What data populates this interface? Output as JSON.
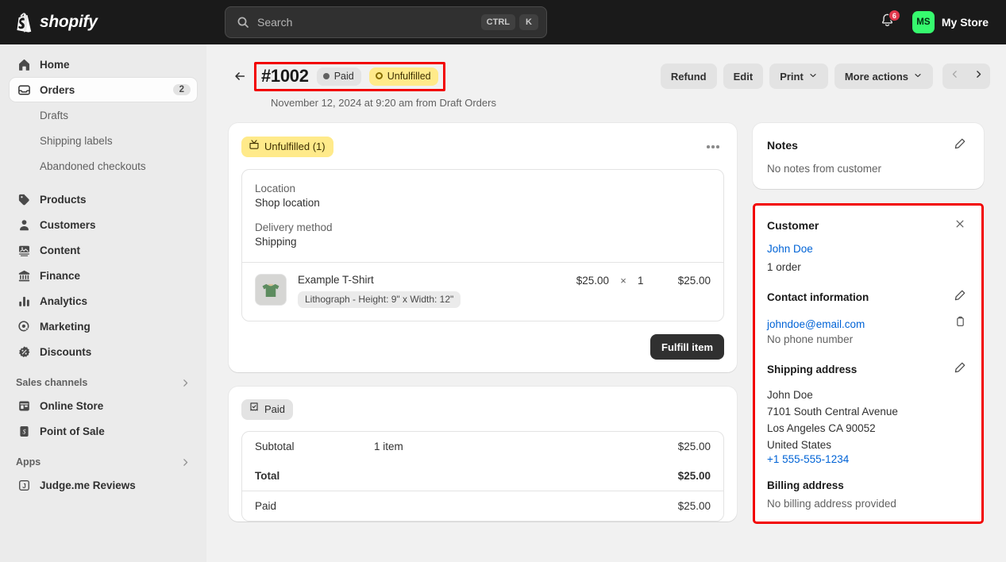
{
  "topbar": {
    "brand_name": "shopify",
    "brand_icon": "shopify-bag-icon",
    "search": {
      "placeholder": "Search",
      "icon": "search-icon",
      "kbd_ctrl": "CTRL",
      "kbd_k": "K"
    },
    "notifications": {
      "icon": "bell-icon",
      "count": "6"
    },
    "store": {
      "initials": "MS",
      "name": "My Store",
      "avatar_color": "#36fa6e"
    }
  },
  "sidebar": {
    "items": [
      {
        "label": "Home",
        "icon": "home-icon",
        "badge": "",
        "active": false
      },
      {
        "label": "Orders",
        "icon": "orders-inbox-icon",
        "badge": "2",
        "active": true
      }
    ],
    "sub_items": [
      {
        "label": "Drafts"
      },
      {
        "label": "Shipping labels"
      },
      {
        "label": "Abandoned checkouts"
      }
    ],
    "items2": [
      {
        "label": "Products",
        "icon": "tag-icon"
      },
      {
        "label": "Customers",
        "icon": "person-icon"
      },
      {
        "label": "Content",
        "icon": "content-image-icon"
      },
      {
        "label": "Finance",
        "icon": "bank-icon"
      },
      {
        "label": "Analytics",
        "icon": "bar-chart-icon"
      },
      {
        "label": "Marketing",
        "icon": "target-cursor-icon"
      },
      {
        "label": "Discounts",
        "icon": "discount-badge-icon"
      }
    ],
    "sales_channels": {
      "title": "Sales channels",
      "items": [
        {
          "label": "Online Store",
          "icon": "storefront-icon"
        },
        {
          "label": "Point of Sale",
          "icon": "pos-receipt-icon"
        }
      ]
    },
    "apps": {
      "title": "Apps",
      "items": [
        {
          "label": "Judge.me Reviews",
          "icon": "judgeme-app-icon",
          "initial": "J"
        }
      ]
    }
  },
  "order": {
    "number": "#1002",
    "status_payment": "Paid",
    "status_fulfillment": "Unfulfilled",
    "subtitle": "November 12, 2024 at 9:20 am from Draft Orders",
    "actions": {
      "refund": "Refund",
      "edit": "Edit",
      "print": "Print",
      "more_actions": "More actions"
    }
  },
  "fulfillment_card": {
    "badge": "Unfulfilled (1)",
    "location_label": "Location",
    "location_value": "Shop location",
    "delivery_label": "Delivery method",
    "delivery_value": "Shipping",
    "item": {
      "title": "Example T-Shirt",
      "variant": "Lithograph - Height: 9\" x Width: 12\"",
      "price": "$25.00",
      "times": "×",
      "quantity": "1",
      "total": "$25.00"
    },
    "fulfill_button": "Fulfill item"
  },
  "payment_card": {
    "badge": "Paid",
    "rows": [
      {
        "label": "Subtotal",
        "mid": "1 item",
        "amount": "$25.00",
        "bold": false
      },
      {
        "label": "Total",
        "mid": "",
        "amount": "$25.00",
        "bold": true
      }
    ],
    "paid_row": {
      "label": "Paid",
      "amount": "$25.00"
    }
  },
  "notes_card": {
    "title": "Notes",
    "body": "No notes from customer",
    "edit_icon": "pencil-icon"
  },
  "customer_card": {
    "title": "Customer",
    "close_icon": "close-icon",
    "name": "John Doe",
    "order_count": "1 order",
    "contact_title": "Contact information",
    "email": "johndoe@email.com",
    "copy_icon": "clipboard-copy-icon",
    "phone_note": "No phone number",
    "shipping_title": "Shipping address",
    "shipping_lines": [
      "John Doe",
      "7101 South Central Avenue",
      "Los Angeles CA 90052",
      "United States"
    ],
    "shipping_phone": "+1 555-555-1234",
    "billing_title": "Billing address",
    "billing_body": "No billing address provided"
  },
  "highlights": {
    "color": "#f20000",
    "targets": [
      "order-title",
      "customer-card"
    ]
  }
}
